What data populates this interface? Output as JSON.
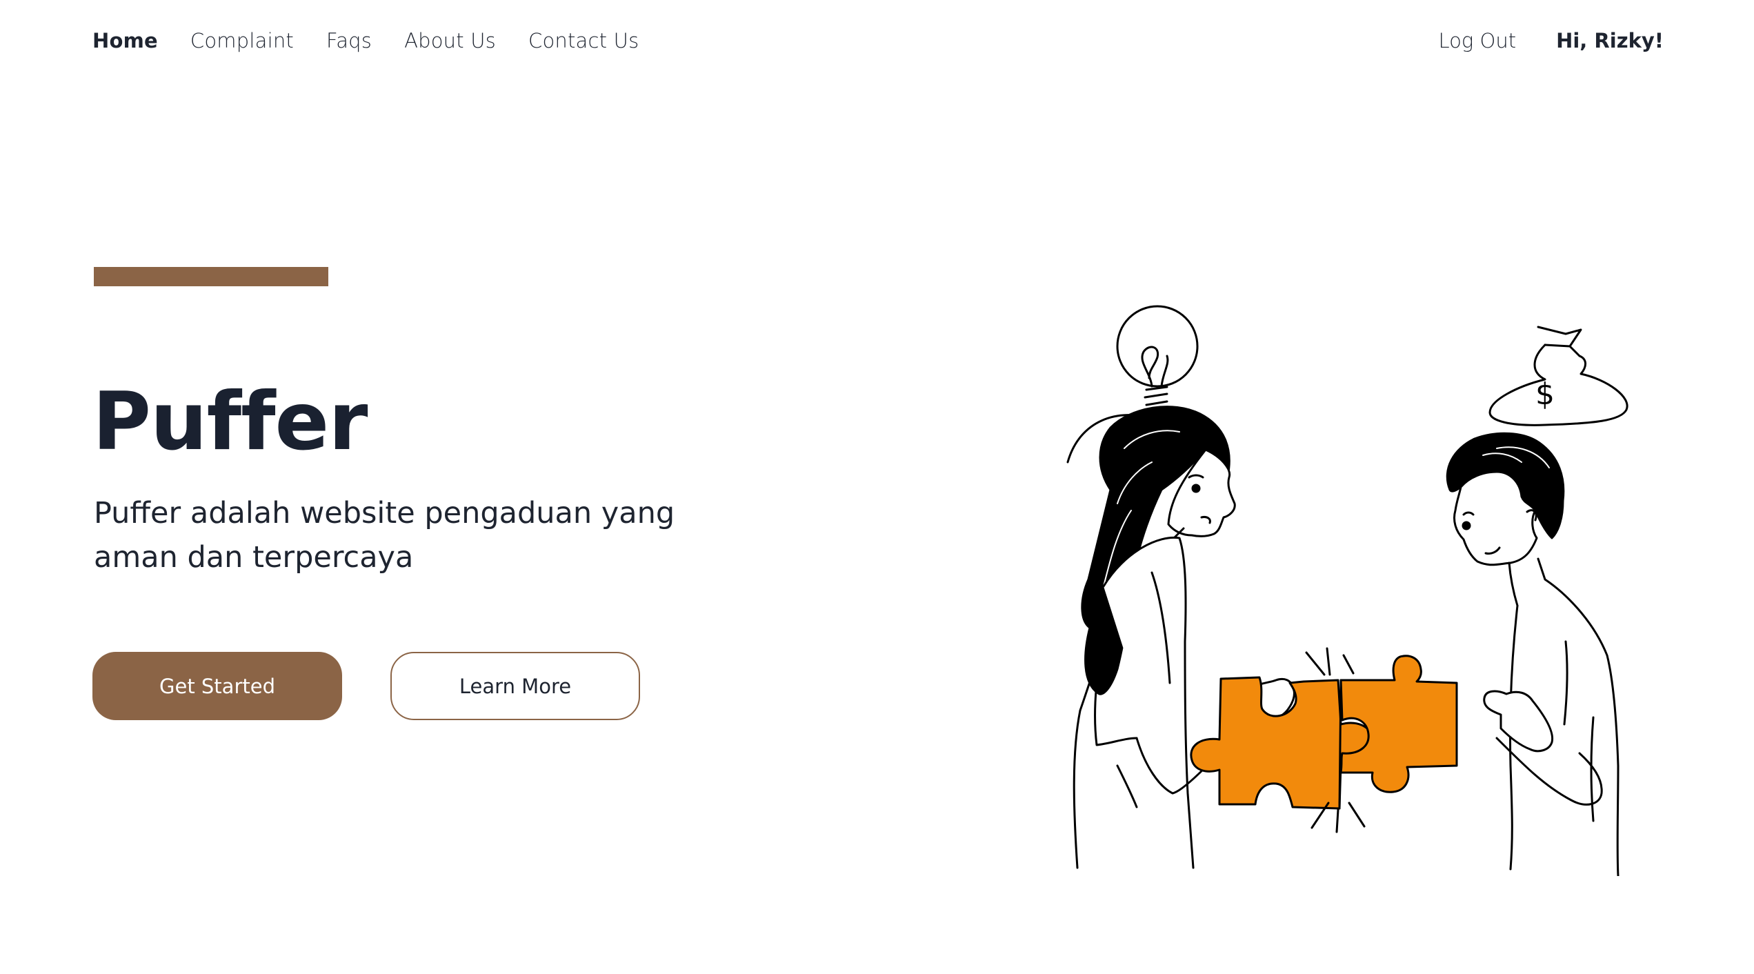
{
  "nav": {
    "items": [
      {
        "label": "Home",
        "active": true
      },
      {
        "label": "Complaint",
        "active": false
      },
      {
        "label": "Faqs",
        "active": false
      },
      {
        "label": "About Us",
        "active": false
      },
      {
        "label": "Contact Us",
        "active": false
      }
    ],
    "logout_label": "Log Out",
    "greeting_prefix": "Hi,",
    "user_name": "Rizky!"
  },
  "hero": {
    "title": "Puffer",
    "subtitle": "Puffer adalah website pengaduan yang aman dan terpercaya",
    "primary_button": "Get Started",
    "secondary_button": "Learn More"
  },
  "colors": {
    "accent": "#8b6446",
    "text": "#1e2430",
    "puzzle": "#f28a0c",
    "background": "#ffffff"
  },
  "illustration": {
    "icon": "two-people-puzzle-illustration",
    "money_bag_symbol": "$"
  }
}
